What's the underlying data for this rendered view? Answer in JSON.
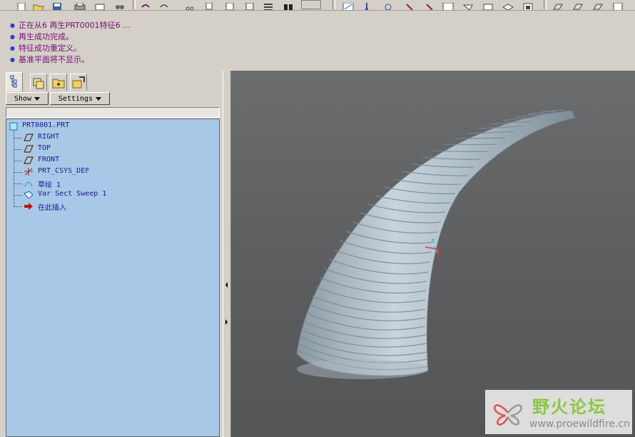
{
  "messages": [
    "正在从6 再生PRT0001特征6 ...",
    "再生成功完成。",
    "特征成功重定义。",
    "基准平面将不显示。"
  ],
  "panel": {
    "show_label": "Show",
    "settings_label": "Settings"
  },
  "tree": {
    "root": "PRT0001.PRT",
    "items": [
      {
        "label": "RIGHT",
        "icon": "datum-plane-icon"
      },
      {
        "label": "TOP",
        "icon": "datum-plane-icon"
      },
      {
        "label": "FRONT",
        "icon": "datum-plane-icon"
      },
      {
        "label": "PRT_CSYS_DEF",
        "icon": "csys-icon"
      },
      {
        "label": "草绘 1",
        "icon": "sketch-icon"
      },
      {
        "label": "Var Sect Sweep 1",
        "icon": "sweep-icon"
      },
      {
        "label": "在此插入",
        "icon": "insert-here-arrow-icon"
      }
    ]
  },
  "watermark": {
    "title": "野火论坛",
    "url": "www.proewildfire.cn"
  },
  "colors": {
    "message_text": "#7a0b7a",
    "bullet": "#2a44c8",
    "tree_background": "#a8c8e8",
    "tree_text": "#1a1a8a",
    "viewport": "#5f6062",
    "model": "#b4c2cc",
    "watermark_green": "#8cc63f"
  }
}
